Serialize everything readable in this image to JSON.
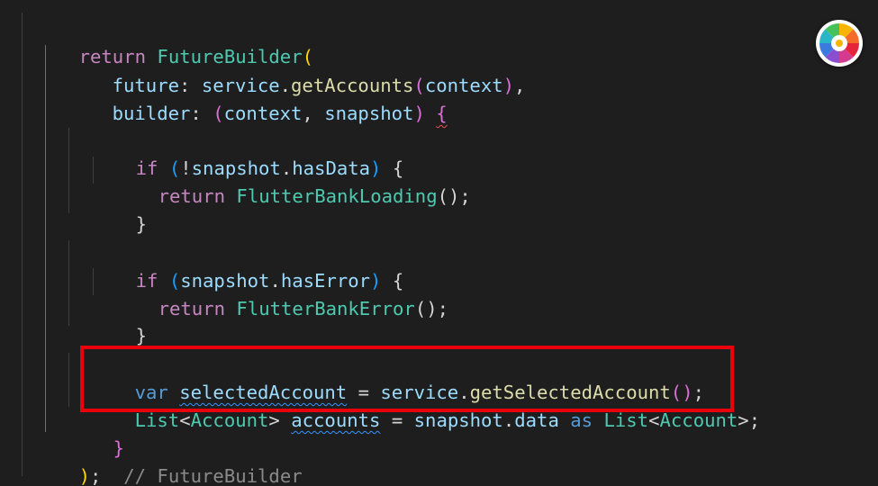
{
  "editor": {
    "language": "dart",
    "highlight_color": "#e8000b",
    "lines": {
      "l1": {
        "return": "return",
        "class": "FutureBuilder",
        "open": "("
      },
      "l2": {
        "param": "future",
        "colon": ": ",
        "obj": "service",
        "dot": ".",
        "method": "getAccounts",
        "open": "(",
        "arg": "context",
        "close": ")",
        "comma": ","
      },
      "l3": {
        "param": "builder",
        "colon": ": ",
        "open": "(",
        "arg1": "context",
        "sep": ", ",
        "arg2": "snapshot",
        "close": ")",
        "space": " ",
        "brace": "{"
      },
      "l4": {
        "kw": "if",
        "open": " (",
        "not": "!",
        "obj": "snapshot",
        "dot": ".",
        "prop": "hasData",
        "close": ")",
        "space": " ",
        "brace": "{"
      },
      "l5": {
        "kw": "return",
        "class": "FlutterBankLoading",
        "call": "()",
        "semi": ";"
      },
      "l6": {
        "brace": "}"
      },
      "l7": {
        "kw": "if",
        "open": " (",
        "obj": "snapshot",
        "dot": ".",
        "prop": "hasError",
        "close": ")",
        "space": " ",
        "brace": "{"
      },
      "l8": {
        "kw": "return",
        "class": "FlutterBankError",
        "call": "()",
        "semi": ";"
      },
      "l9": {
        "brace": "}"
      },
      "l10": {
        "kw": "var",
        "name": "selectedAccount",
        "eq": " = ",
        "obj": "service",
        "dot": ".",
        "method": "getSelectedAccount",
        "call": "()",
        "semi": ";"
      },
      "l11": {
        "type": "List",
        "lt": "<",
        "inner": "Account",
        "gt": ">",
        "name": "accounts",
        "eq": " = ",
        "obj": "snapshot",
        "dot": ".",
        "prop": "data",
        "as": "as",
        "type2": "List",
        "lt2": "<",
        "inner2": "Account",
        "gt2": ">",
        "semi": ";"
      },
      "l12": {
        "brace": "}"
      },
      "l13": {
        "close": ")",
        "semi": ";",
        "comment": "// FutureBuilder"
      }
    }
  },
  "toolbar": {
    "icon": "color-wheel-icon"
  }
}
